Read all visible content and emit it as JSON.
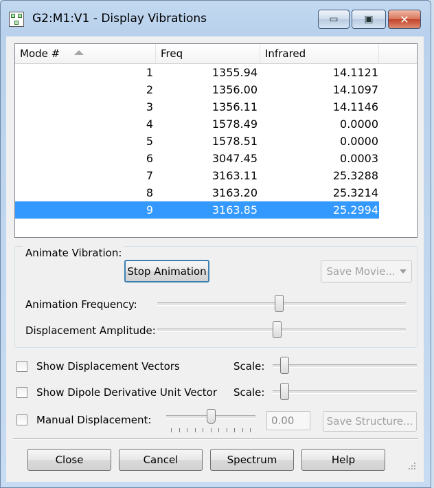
{
  "window": {
    "title": "G2:M1:V1 - Display Vibrations",
    "controls": {
      "minimize": "▭",
      "maximize": "▣",
      "close": "✕"
    }
  },
  "table": {
    "columns": [
      "Mode #",
      "Freq",
      "Infrared"
    ],
    "sort_column": "Mode #",
    "sort_direction": "ascending",
    "rows": [
      {
        "mode": "1",
        "freq": "1355.94",
        "ir": "14.1121"
      },
      {
        "mode": "2",
        "freq": "1356.00",
        "ir": "14.1097"
      },
      {
        "mode": "3",
        "freq": "1356.11",
        "ir": "14.1146"
      },
      {
        "mode": "4",
        "freq": "1578.49",
        "ir": "0.0000"
      },
      {
        "mode": "5",
        "freq": "1578.51",
        "ir": "0.0000"
      },
      {
        "mode": "6",
        "freq": "3047.45",
        "ir": "0.0003"
      },
      {
        "mode": "7",
        "freq": "3163.11",
        "ir": "25.3288"
      },
      {
        "mode": "8",
        "freq": "3163.20",
        "ir": "25.3214"
      },
      {
        "mode": "9",
        "freq": "3163.85",
        "ir": "25.2994"
      }
    ],
    "selected_mode": "9"
  },
  "animate": {
    "group_title": "Animate Vibration:",
    "stop_button": "Stop Animation",
    "save_movie": "Save Movie...",
    "frequency_label": "Animation Frequency:",
    "frequency_level": 0.49,
    "amplitude_label": "Displacement Amplitude:",
    "amplitude_level": 0.48
  },
  "options": {
    "show_vectors": "Show Displacement Vectors",
    "show_dipole": "Show Dipole Derivative Unit Vector",
    "manual": "Manual Displacement:",
    "scale_label": "Scale:",
    "vectors_scale_level": 0.08,
    "dipole_scale_level": 0.08,
    "manual_level": 0.5,
    "manual_value": "0.00",
    "save_structure": "Save Structure..."
  },
  "buttons": {
    "close": "Close",
    "cancel": "Cancel",
    "spectrum": "Spectrum",
    "help": "Help"
  },
  "colors": {
    "selection": "#3399ff",
    "title_bar": "#b9d1ec",
    "close_button": "#c0432a"
  },
  "icons": {
    "app": "molecule-app-icon",
    "sort": "sort-ascending-icon",
    "dropdown": "chevron-down-icon",
    "grip": "resize-grip-icon"
  }
}
